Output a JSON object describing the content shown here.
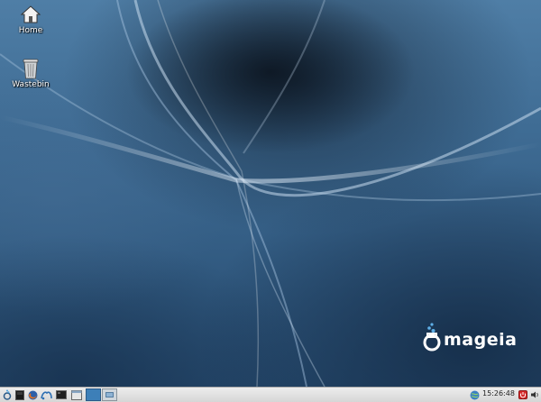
{
  "desktop": {
    "icons": [
      {
        "label": "Home",
        "icon": "home-icon"
      },
      {
        "label": "Wastebin",
        "icon": "trash-icon"
      }
    ],
    "logo_text": "mageia"
  },
  "taskbar": {
    "launchers": [
      "start-menu-icon",
      "terminal-icon",
      "firefox-icon",
      "mail-icon",
      "console-icon",
      "file-manager-icon"
    ],
    "workspaces": [
      "workspace-1",
      "workspace-2"
    ],
    "tray": [
      "network-icon",
      "power-icon",
      "volume-icon"
    ],
    "clock": "15:26:48"
  },
  "colors": {
    "panel": "#dcdcdc",
    "desktop_base": "#3e6b93",
    "workspace_active": "#3d7fb8"
  }
}
